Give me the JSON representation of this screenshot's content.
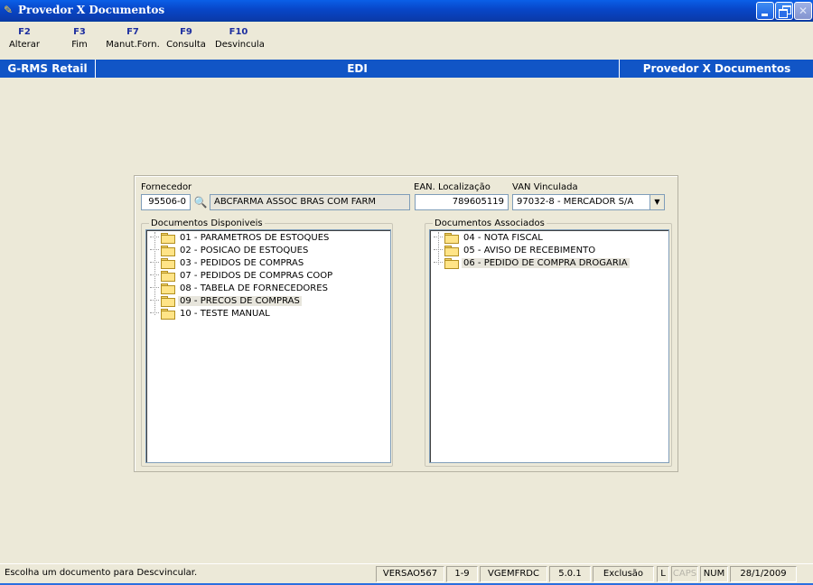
{
  "window": {
    "title": "Provedor X Documentos",
    "icon": "app-icon"
  },
  "toolbar": {
    "keys": [
      {
        "key": "F2",
        "label": "Alterar"
      },
      {
        "key": "F3",
        "label": "Fim"
      },
      {
        "key": "F7",
        "label": "Manut.Forn."
      },
      {
        "key": "F9",
        "label": "Consulta"
      },
      {
        "key": "F10",
        "label": "Desvincula"
      }
    ]
  },
  "band": {
    "left": "G-RMS Retail",
    "center": "EDI",
    "right": "Provedor X Documentos"
  },
  "form": {
    "fornecedor_label": "Fornecedor",
    "fornecedor_code": "95506-0",
    "fornecedor_name": "ABCFARMA ASSOC BRAS COM FARM",
    "ean_label": "EAN. Localização",
    "ean_value": "789605119",
    "van_label": "VAN Vinculada",
    "van_value": "97032-8 - MERCADOR S/A"
  },
  "disponiveis": {
    "title": "Documentos Disponiveis",
    "items": [
      "01 - PARAMETROS DE ESTOQUES",
      "02 - POSICAO DE ESTOQUES",
      "03 - PEDIDOS DE COMPRAS",
      "07 - PEDIDOS DE COMPRAS COOP",
      "08 - TABELA DE FORNECEDORES",
      "09 - PRECOS DE COMPRAS",
      "10 - TESTE MANUAL"
    ],
    "selected_index": 5
  },
  "associados": {
    "title": "Documentos Associados",
    "items": [
      "04 - NOTA FISCAL",
      "05 - AVISO DE RECEBIMENTO",
      "06 - PEDIDO DE COMPRA DROGARIA"
    ],
    "selected_index": 2
  },
  "status": {
    "message": "Escolha um documento para Descvincular.",
    "version": "VERSAO567",
    "range": "1-9",
    "program": "VGEMFRDC",
    "release": "5.0.1",
    "mode": "Exclusão",
    "l": "L",
    "caps": "CAPS",
    "num": "NUM",
    "date": "28/1/2009"
  }
}
